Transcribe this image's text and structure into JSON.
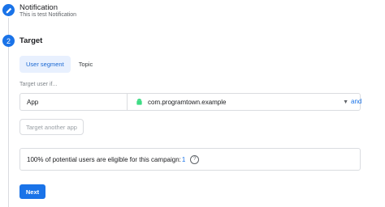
{
  "steps": {
    "notification": {
      "title": "Notification",
      "subtitle": "This is test Notification"
    },
    "target": {
      "number": "2",
      "title": "Target",
      "tabs": [
        {
          "label": "User segment",
          "active": true
        },
        {
          "label": "Topic",
          "active": false
        }
      ],
      "hint": "Target user if...",
      "criteria": {
        "field": "App",
        "value": "com.programtown.example",
        "conjunction": "and"
      },
      "add_another_label": "Target another app",
      "eligible_text": "100% of potential users are eligible for this campaign:",
      "eligible_count": "1",
      "next_label": "Next"
    }
  },
  "colors": {
    "accent": "#1a73e8",
    "tab_active_bg": "#e8f0fe",
    "border": "#dadce0"
  },
  "icons": {
    "step1": "pencil-icon",
    "app": "android-icon",
    "dropdown": "caret-down-icon",
    "help": "help-icon"
  }
}
